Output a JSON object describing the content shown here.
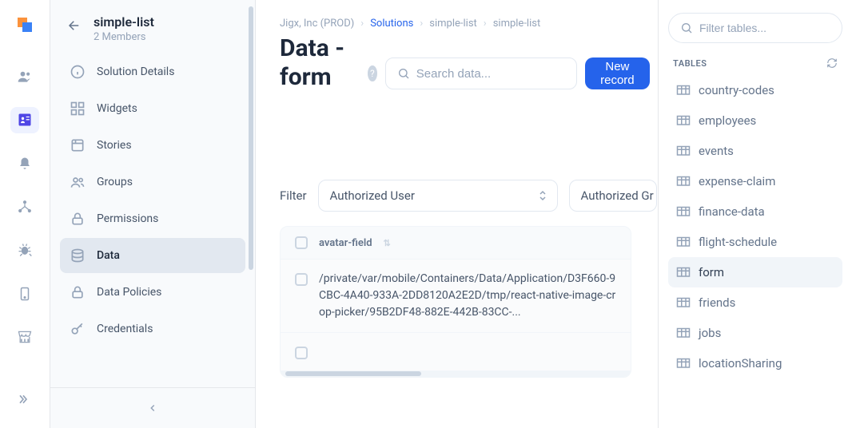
{
  "rail": {},
  "sidebar": {
    "title": "simple-list",
    "subtitle": "2 Members",
    "items": [
      {
        "label": "Solution Details"
      },
      {
        "label": "Widgets"
      },
      {
        "label": "Stories"
      },
      {
        "label": "Groups"
      },
      {
        "label": "Permissions"
      },
      {
        "label": "Data"
      },
      {
        "label": "Data Policies"
      },
      {
        "label": "Credentials"
      }
    ]
  },
  "breadcrumb": {
    "org": "Jigx, Inc (PROD)",
    "solutions": "Solutions",
    "item1": "simple-list",
    "item2": "simple-list"
  },
  "page": {
    "title": "Data - form"
  },
  "toolbar": {
    "search_placeholder": "Search data...",
    "new_record": "New record"
  },
  "filter": {
    "label": "Filter",
    "select1": "Authorized User",
    "select2": "Authorized Gr"
  },
  "table": {
    "col1": "avatar-field",
    "rows": [
      {
        "val": "/private/var/mobile/Containers/Data/Application/D3F660-9CBC-4A40-933A-2DD8120A2E2D/tmp/react-native-image-crop-picker/95B2DF48-882E-442B-83CC-..."
      },
      {
        "val": ""
      }
    ]
  },
  "right": {
    "search_placeholder": "Filter tables...",
    "section": "TABLES",
    "tables": [
      "country-codes",
      "employees",
      "events",
      "expense-claim",
      "finance-data",
      "flight-schedule",
      "form",
      "friends",
      "jobs",
      "locationSharing"
    ]
  }
}
